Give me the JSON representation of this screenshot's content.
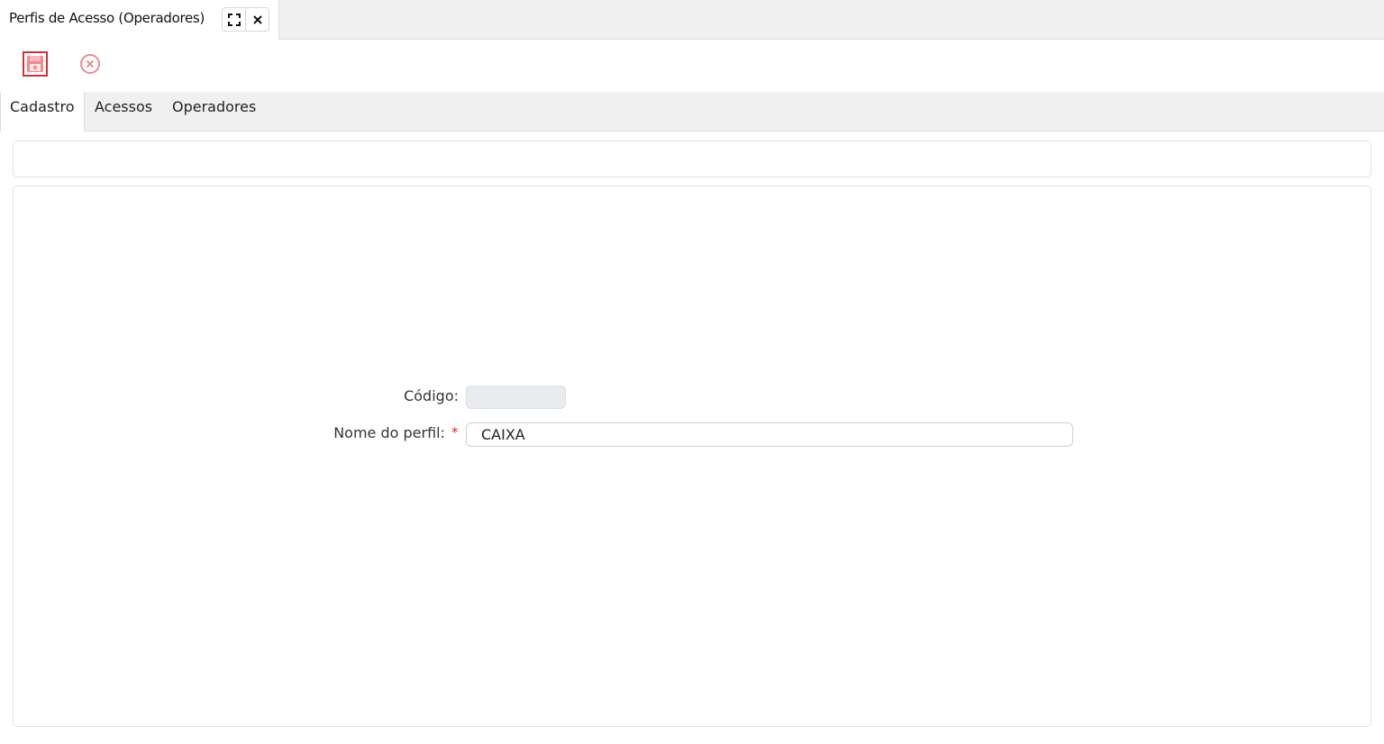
{
  "window": {
    "tab_title": "Perfis de Acesso (Operadores)",
    "maximize_icon": "maximize-icon",
    "close_icon": "close-icon"
  },
  "toolbar": {
    "save_icon": "floppy-disk-icon",
    "cancel_icon": "circle-x-icon"
  },
  "tabs": [
    {
      "label": "Cadastro",
      "active": true
    },
    {
      "label": "Acessos",
      "active": false
    },
    {
      "label": "Operadores",
      "active": false
    }
  ],
  "form": {
    "codigo_label": "Código:",
    "codigo_value": "",
    "nome_label": "Nome do perfil:",
    "nome_required": "*",
    "nome_value": "CAIXA"
  },
  "colors": {
    "accent_red": "#d32f3a",
    "tab_bar_bg": "#efefef",
    "disabled_input_bg": "#e9ecef"
  }
}
